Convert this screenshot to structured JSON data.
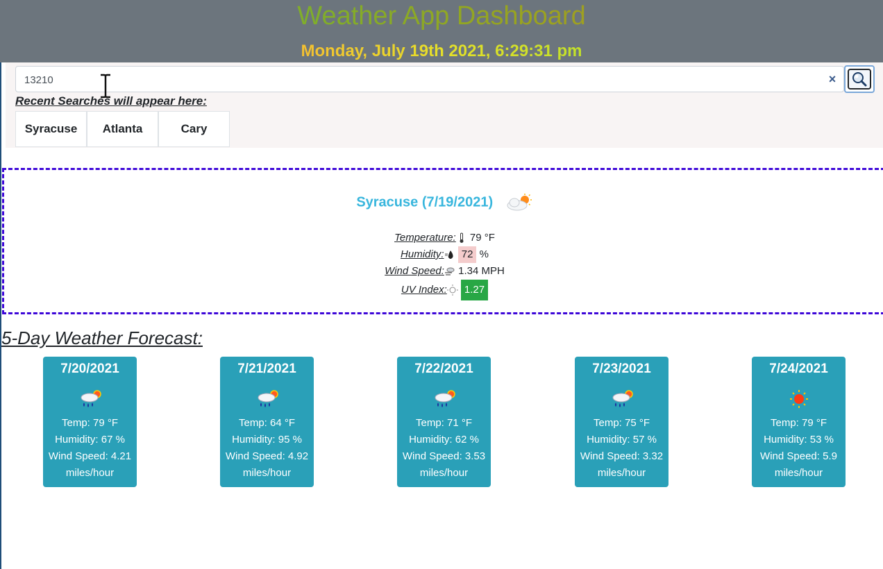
{
  "header": {
    "title": "Weather App Dashboard",
    "datetime": "Monday, July 19th 2021, 6:29:31 pm"
  },
  "search": {
    "value": "13210",
    "clear_glyph": "×",
    "button_icon": "magnifier-icon"
  },
  "recent": {
    "label": "Recent Searches will appear here:",
    "items": [
      "Syracuse",
      "Atlanta",
      "Cary"
    ]
  },
  "current": {
    "city_date": "Syracuse (7/19/2021)",
    "icon": "partly-cloudy-icon",
    "temperature_label": "Temperature:",
    "temperature_value": "79 °F",
    "humidity_label": "Humidity:",
    "humidity_value": "72",
    "humidity_unit": "%",
    "wind_label": "Wind Speed:",
    "wind_value": "1.34 MPH",
    "uv_label": "UV Index:",
    "uv_value": "1.27",
    "uv_color": "#28a745"
  },
  "forecast": {
    "title": "5-Day Weather Forecast:",
    "days": [
      {
        "date": "7/20/2021",
        "icon": "rain-sun-icon",
        "temp": "Temp: 79 °F",
        "humidity": "Humidity: 67 %",
        "wind": "Wind Speed: 4.21",
        "wind_unit": "miles/hour"
      },
      {
        "date": "7/21/2021",
        "icon": "rain-sun-icon",
        "temp": "Temp: 64 °F",
        "humidity": "Humidity: 95 %",
        "wind": "Wind Speed: 4.92",
        "wind_unit": "miles/hour"
      },
      {
        "date": "7/22/2021",
        "icon": "rain-sun-icon",
        "temp": "Temp: 71 °F",
        "humidity": "Humidity: 62 %",
        "wind": "Wind Speed: 3.53",
        "wind_unit": "miles/hour"
      },
      {
        "date": "7/23/2021",
        "icon": "rain-sun-icon",
        "temp": "Temp: 75 °F",
        "humidity": "Humidity: 57 %",
        "wind": "Wind Speed: 3.32",
        "wind_unit": "miles/hour"
      },
      {
        "date": "7/24/2021",
        "icon": "sun-icon",
        "temp": "Temp: 79 °F",
        "humidity": "Humidity: 53 %",
        "wind": "Wind Speed: 5.9",
        "wind_unit": "miles/hour"
      }
    ]
  },
  "colors": {
    "header_bg": "#6c757d",
    "card_bg": "#2aa0b8",
    "city_color": "#38b6dd",
    "dashed_border": "#3d06d8"
  }
}
